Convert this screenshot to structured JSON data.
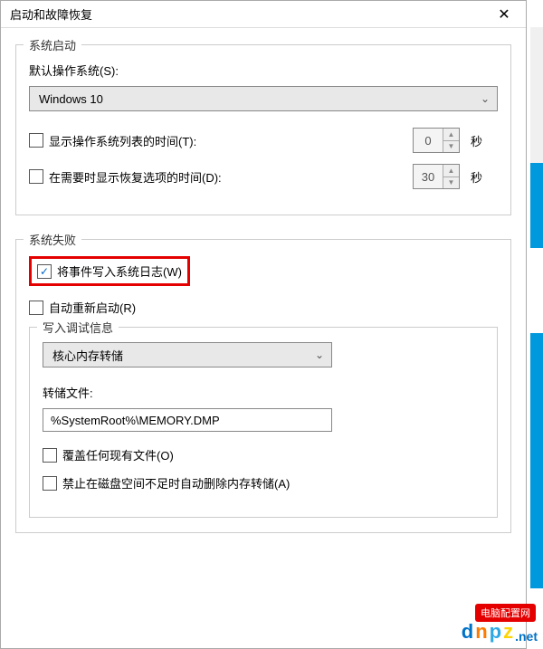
{
  "window": {
    "title": "启动和故障恢复",
    "close": "✕"
  },
  "startup": {
    "legend": "系统启动",
    "default_os_label": "默认操作系统(S):",
    "default_os_value": "Windows 10",
    "show_list_label": "显示操作系统列表的时间(T):",
    "show_list_checked": false,
    "show_list_value": "0",
    "show_recovery_label": "在需要时显示恢复选项的时间(D):",
    "show_recovery_checked": false,
    "show_recovery_value": "30",
    "unit": "秒"
  },
  "failure": {
    "legend": "系统失败",
    "write_log_label": "将事件写入系统日志(W)",
    "write_log_checked": true,
    "auto_restart_label": "自动重新启动(R)",
    "auto_restart_checked": false,
    "debug": {
      "legend": "写入调试信息",
      "dump_type": "核心内存转储",
      "dump_file_label": "转储文件:",
      "dump_file_value": "%SystemRoot%\\MEMORY.DMP",
      "overwrite_label": "覆盖任何现有文件(O)",
      "overwrite_checked": false,
      "no_delete_label": "禁止在磁盘空间不足时自动删除内存转储(A)",
      "no_delete_checked": false
    }
  },
  "watermark": {
    "tag": "电脑配置网",
    "d": "d",
    "n": "n",
    "p": "p",
    "z": "z",
    "net": ".net"
  }
}
